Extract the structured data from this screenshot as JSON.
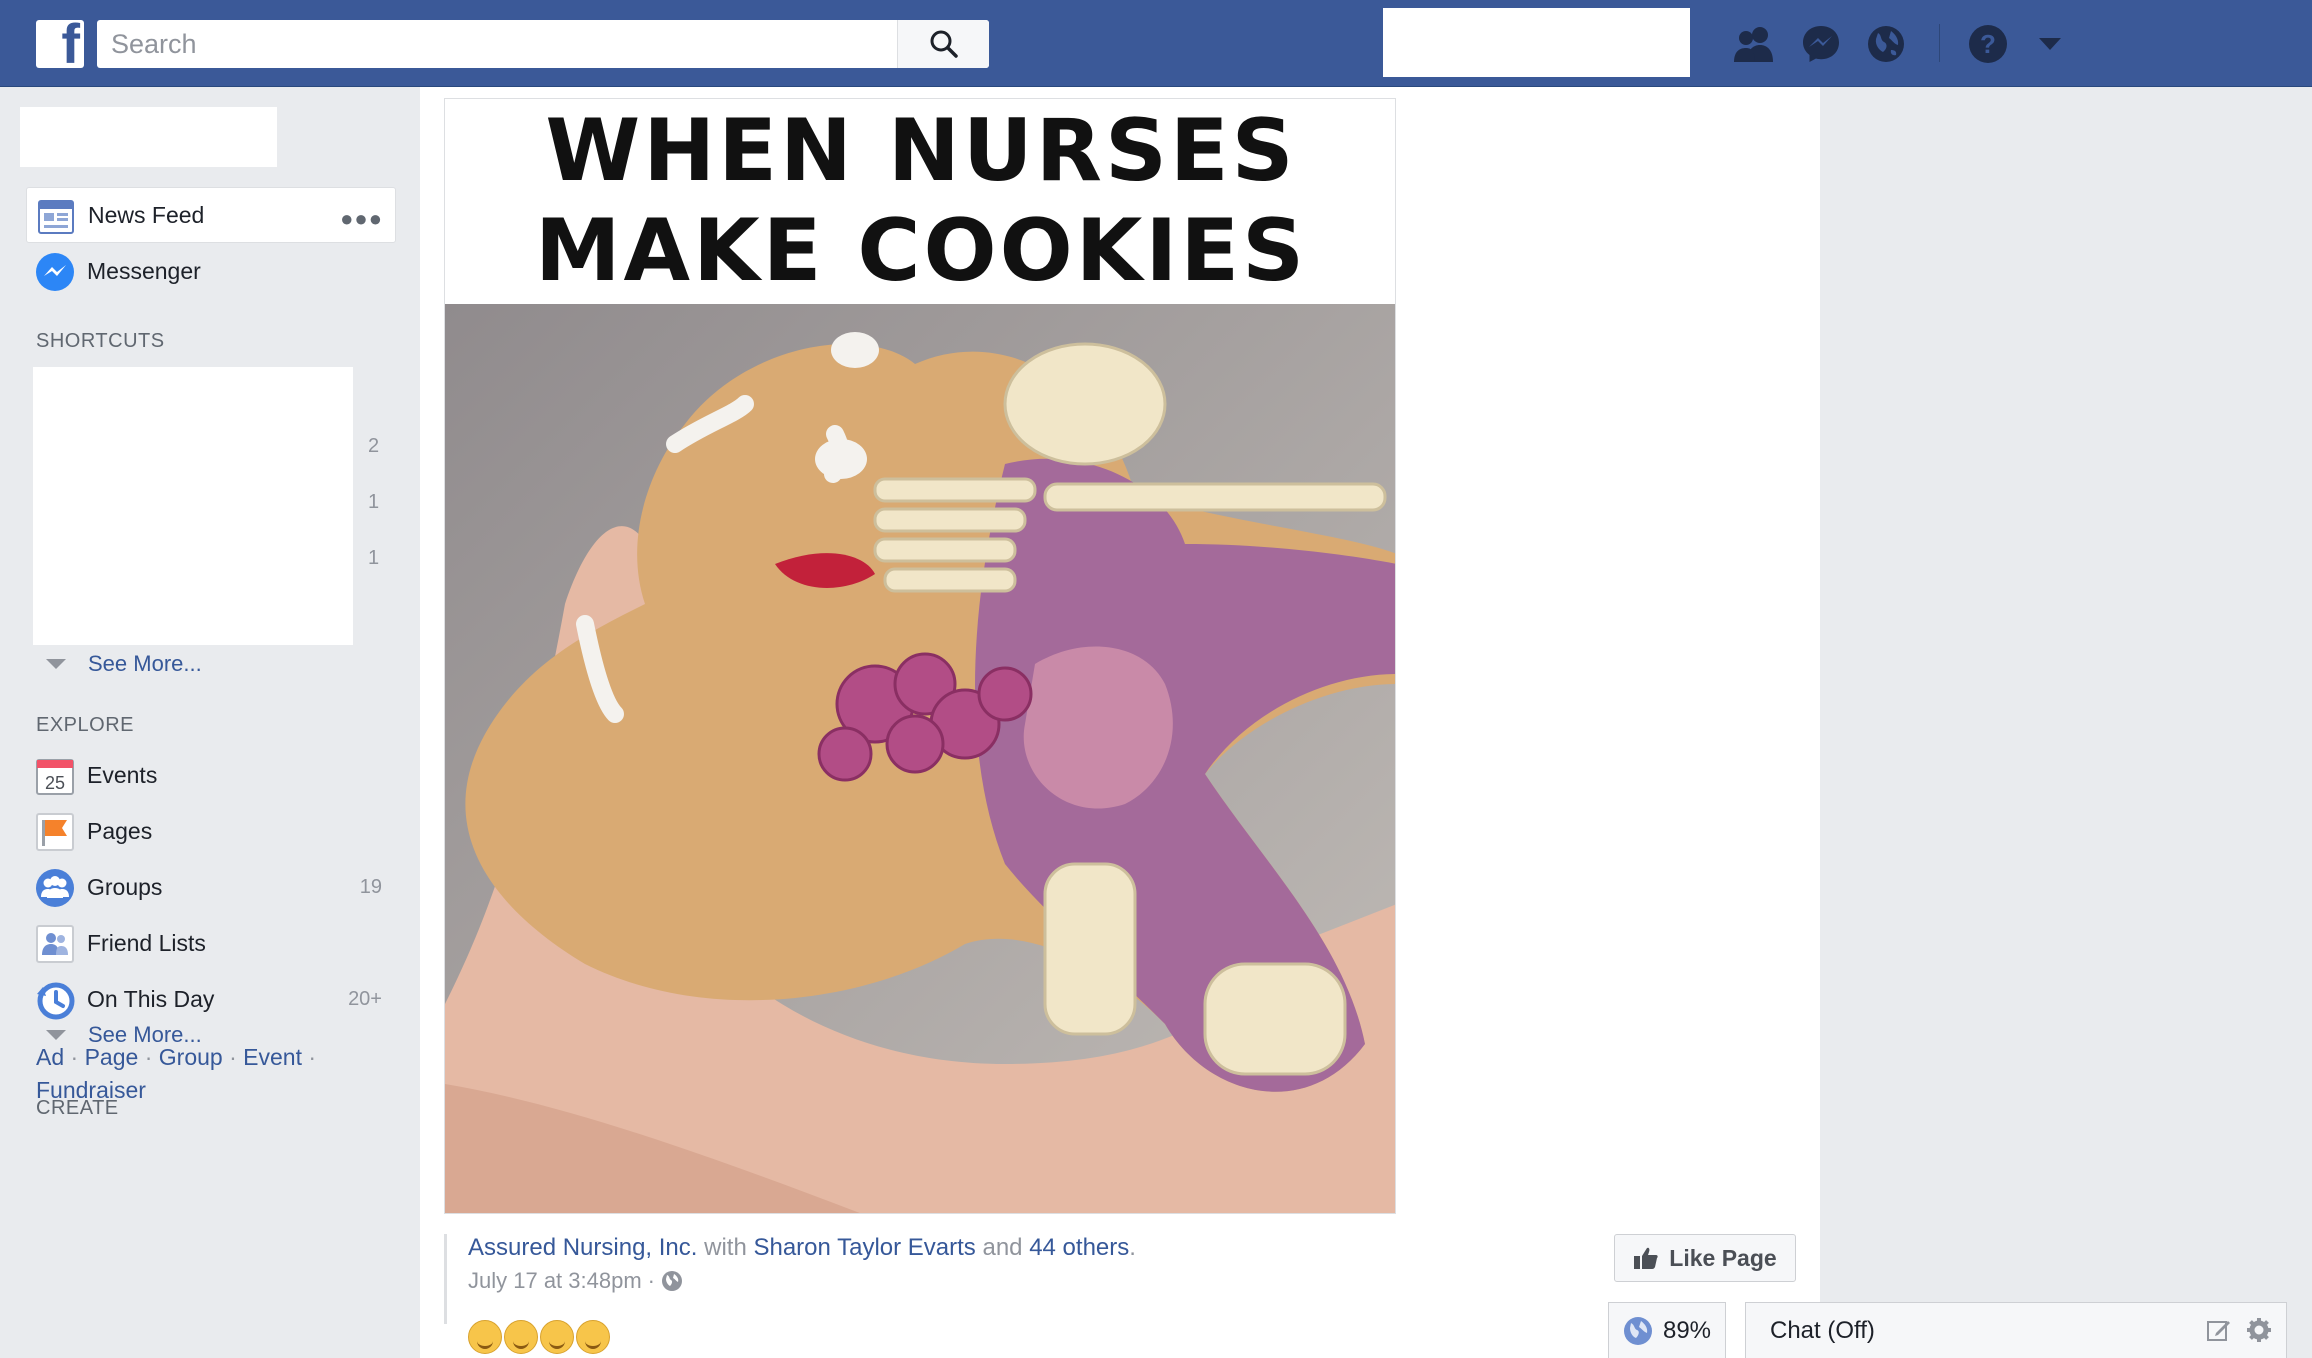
{
  "header": {
    "search_placeholder": "Search",
    "brand_color": "#3b5998",
    "icons": [
      "friend-requests-icon",
      "messages-icon",
      "notifications-icon",
      "help-icon",
      "account-menu-icon"
    ]
  },
  "sidebar": {
    "main_items": [
      {
        "label": "News Feed",
        "icon": "news-feed-icon"
      },
      {
        "label": "Messenger",
        "icon": "messenger-icon"
      }
    ],
    "shortcuts_heading": "SHORTCUTS",
    "shortcut_counts": [
      "2",
      "1",
      "1"
    ],
    "see_more_1": "See More...",
    "explore_heading": "EXPLORE",
    "explore_items": [
      {
        "label": "Events",
        "count": "",
        "icon": "calendar-icon",
        "icon_text": "25"
      },
      {
        "label": "Pages",
        "count": "",
        "icon": "flag-icon"
      },
      {
        "label": "Groups",
        "count": "19",
        "icon": "groups-icon"
      },
      {
        "label": "Friend Lists",
        "count": "",
        "icon": "friend-lists-icon"
      },
      {
        "label": "On This Day",
        "count": "20+",
        "icon": "clock-icon"
      }
    ],
    "see_more_2": "See More...",
    "create_heading": "CREATE",
    "create_links": [
      "Ad",
      "Page",
      "Group",
      "Event",
      "Fundraiser"
    ],
    "create_separator": "·"
  },
  "post": {
    "caption_line1": "WHEN NURSES",
    "caption_line2": "MAKE COOKIES",
    "author": "Assured Nursing, Inc.",
    "with_text": "with",
    "tagged": "Sharon Taylor Evarts",
    "and_text": "and",
    "others": "44 others",
    "period": ".",
    "timestamp": "July 17 at 3:48pm",
    "dot": "·",
    "privacy_icon": "globe-icon",
    "reaction_emojis": 4
  },
  "actions": {
    "like_page_label": "Like Page"
  },
  "footer": {
    "perf_value": "89%",
    "chat_label": "Chat (Off)"
  }
}
